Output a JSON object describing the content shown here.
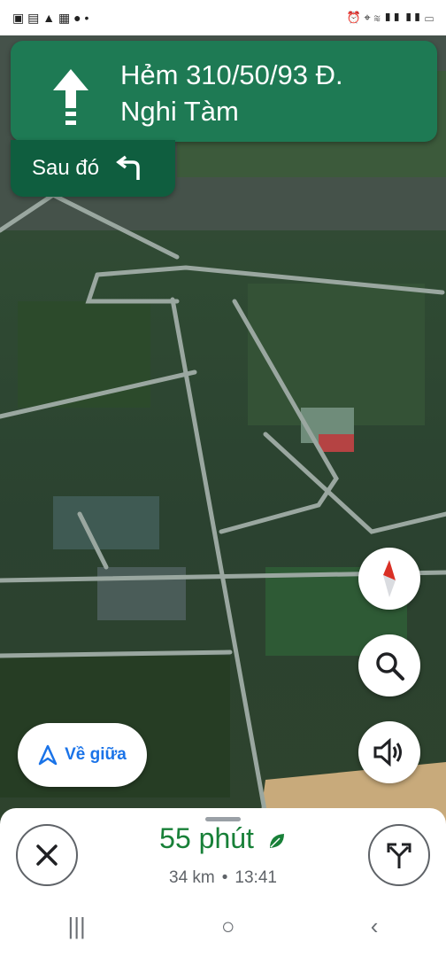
{
  "navigation": {
    "street_line1": "Hẻm 310/50/93 Đ.",
    "street_line2": "Nghi Tàm",
    "then_label": "Sau đó",
    "then_icon": "turn-left-icon",
    "maneuver_icon": "straight-arrow-icon",
    "banner_color": "#1e7a54",
    "then_color": "#0f5e3f"
  },
  "map_controls": {
    "compass_icon": "compass-icon",
    "search_icon": "search-icon",
    "sound_icon": "speaker-icon",
    "recenter_label": "Về giữa",
    "recenter_icon": "navigation-arrow-icon"
  },
  "trip": {
    "duration": "55 phút",
    "distance": "34 km",
    "arrival": "13:41",
    "eco_icon": "leaf-icon",
    "duration_color": "#188038"
  },
  "system_nav": {
    "recents_glyph": "|||",
    "home_glyph": "○",
    "back_glyph": "‹"
  }
}
